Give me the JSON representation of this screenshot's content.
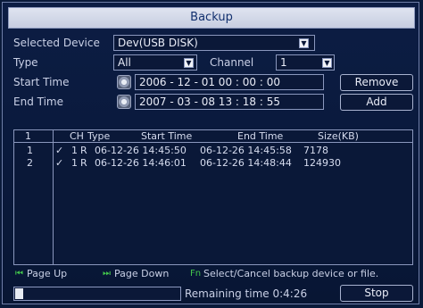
{
  "window": {
    "title": "Backup"
  },
  "form": {
    "selected_device_label": "Selected Device",
    "selected_device_value": "Dev(USB DISK)",
    "type_label": "Type",
    "type_value": "All",
    "channel_label": "Channel",
    "channel_value": "1",
    "start_time_label": "Start Time",
    "start_time_value": "2006 - 12 - 01   00 : 00 : 00",
    "end_time_label": "End Time",
    "end_time_value": "2007 - 03 - 08   13 : 18 : 55",
    "remove_label": "Remove",
    "add_label": "Add"
  },
  "table": {
    "headers": {
      "index": "",
      "ch": "CH",
      "type": "Type",
      "start": "Start Time",
      "end": "End Time",
      "size": "Size(KB)"
    },
    "top_index": "1",
    "rows": [
      {
        "index": "1",
        "check": "✓",
        "ch": "1",
        "type": "R",
        "start": "06-12-26 14:45:50",
        "end": "06-12-26 14:45:58",
        "size": "7178"
      },
      {
        "index": "2",
        "check": "✓",
        "ch": "1",
        "type": "R",
        "start": "06-12-26 14:46:01",
        "end": "06-12-26 14:48:44",
        "size": "124930"
      }
    ]
  },
  "hints": {
    "page_up_icon": "⏮",
    "page_up": "Page Up",
    "page_down_icon": "⏭",
    "page_down": "Page Down",
    "select_icon": "Fn",
    "select_cancel": "Select/Cancel backup device or file."
  },
  "footer": {
    "progress_fraction": 0.05,
    "remaining": "Remaining time 0:4:26",
    "stop_label": "Stop"
  },
  "icons": {
    "clock": "clock-icon",
    "dropdown": "chevron-down-icon"
  },
  "colors": {
    "background": "#0a1a3a",
    "title_bar": "#d3d8e8",
    "accent_green": "#43c64c"
  }
}
